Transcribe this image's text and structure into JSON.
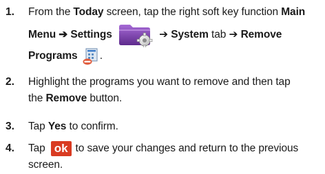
{
  "steps": [
    {
      "number": "1.",
      "line1_pre": "From the ",
      "line1_bold1": "Today",
      "line1_mid": " screen, tap the right soft key function ",
      "line1_bold2": "Main",
      "line2_bold1": "Menu ➔ Settings",
      "line2_arrow_pre": " ➔ ",
      "line2_bold2": "System",
      "line2_mid": " tab ➔ ",
      "line2_bold3": "Remove",
      "line3_bold1": "Programs",
      "line3_post": "."
    },
    {
      "number": "2.",
      "line1": "Highlight the programs you want to remove and then tap",
      "line2_pre": "the ",
      "line2_bold": "Remove",
      "line2_post": " button."
    },
    {
      "number": "3.",
      "pre": "Tap ",
      "bold": "Yes",
      "post": " to confirm."
    },
    {
      "number": "4.",
      "pre": "Tap",
      "key_label": "ok",
      "post": "to save your changes and return to the previous",
      "line2": "screen."
    }
  ],
  "icons": {
    "settings": "settings-folder-icon",
    "remove_programs": "remove-programs-icon"
  },
  "colors": {
    "ok_key": "#d93b22",
    "settings_folder": "#7b3ea8"
  }
}
